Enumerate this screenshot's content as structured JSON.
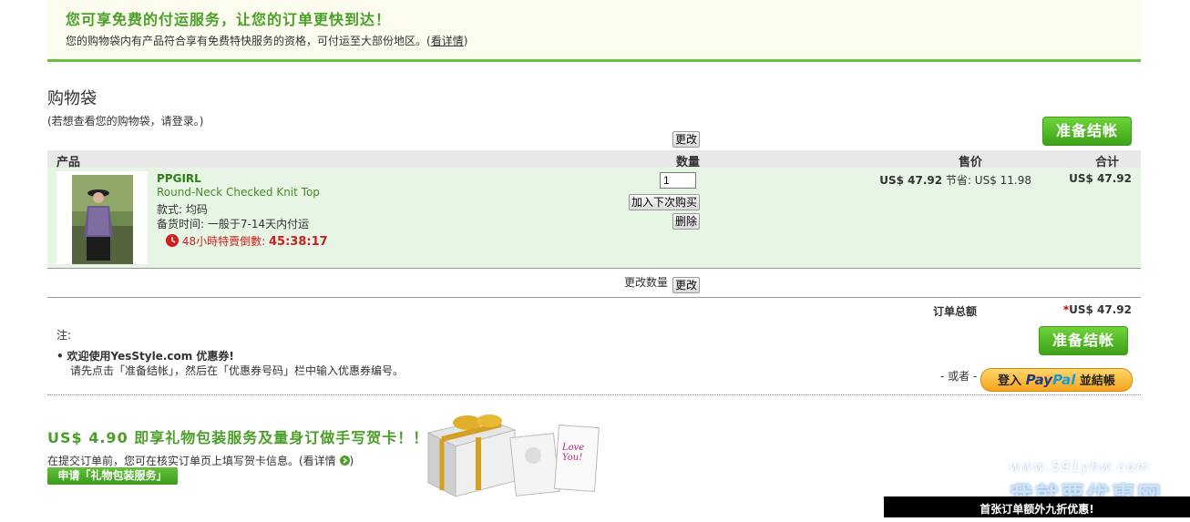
{
  "banner": {
    "title": "您可享免费的付运服务，让您的订单更快到达！",
    "text": "您的购物袋内有产品符合享有免费特快服务的资格，可付运至大部份地区。",
    "paren_open": "(",
    "link": "看详情",
    "paren_close": ")"
  },
  "cart": {
    "title": "购物袋",
    "login_hint_prefix": "(若想查看您的购物袋，请",
    "login_link": "登录",
    "login_hint_suffix": "。)",
    "checkout_label": "准备结帐",
    "change_label": "更改"
  },
  "table": {
    "col_product": "产品",
    "col_qty": "数量",
    "col_price": "售价",
    "col_total": "合计"
  },
  "item": {
    "brand": "PPGIRL",
    "name": "Round-Neck Checked Knit Top",
    "variant": "款式: 均码",
    "ship_time": "备货时间: 一般于7-14天内付运",
    "countdown_label": "48小時特賣倒數:",
    "countdown_time": "45:38:17",
    "qty": "1",
    "move_label": "加入下次购买",
    "delete_label": "删除",
    "price": "US$ 47.92",
    "save_label": "节省:",
    "save_value": "US$ 11.98",
    "total": "US$ 47.92"
  },
  "update": {
    "label": "更改数量",
    "button": "更改"
  },
  "summary": {
    "total_label": "订单总额",
    "asterisk": "*",
    "total_value": "US$ 47.92",
    "note_label": "注:",
    "coupon_title": "欢迎使用YesStyle.com 优惠券!",
    "coupon_text": "请先点击「准备结帐」，然后在「优惠券号码」栏中输入优惠券编号。",
    "checkout_label": "准备结帐",
    "or_label": "- 或者 -",
    "paypal_prefix": "登入",
    "paypal_pay": "Pay",
    "paypal_pal": "Pal",
    "paypal_suffix": "並結帳"
  },
  "gift": {
    "title": "US$ 4.90 即享礼物包装服务及量身订做手写贺卡！！",
    "text": "在提交订单前，您可在核实订单页上填写贺卡信息。(看详情",
    "text_close": ")",
    "button": "申请「礼物包装服务」",
    "card_text": "Love You!"
  },
  "footer": {
    "watermark_url": "www.591yhw.com",
    "watermark_name": "我就要优惠网",
    "promo": "首张订单额外九折优惠!"
  },
  "colors": {
    "brand_green": "#4a9f28",
    "banner_bg": "#fcfdee",
    "row_bg": "#e7f5e4",
    "countdown_red": "#cc1f1f"
  }
}
